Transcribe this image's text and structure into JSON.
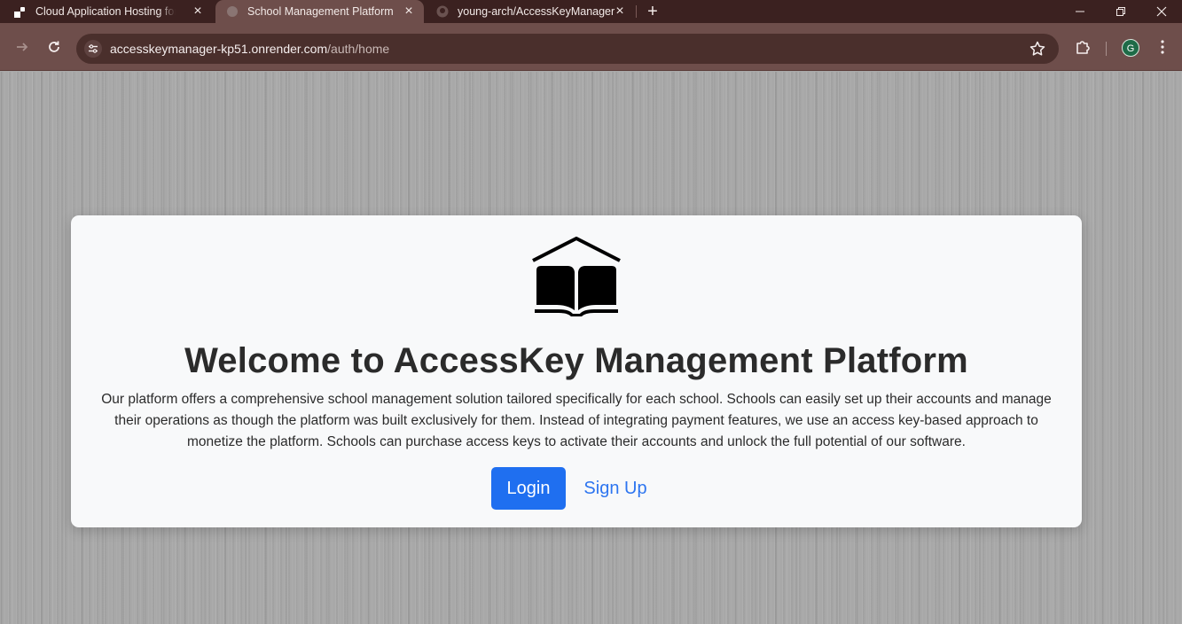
{
  "browser": {
    "tabs": [
      {
        "title": "Cloud Application Hosting for D",
        "favicon": "render-logo-icon"
      },
      {
        "title": "School Management Platform",
        "favicon": "globe-icon"
      },
      {
        "title": "young-arch/AccessKeyManager",
        "favicon": "github-icon"
      }
    ],
    "active_tab": 1,
    "url_domain": "accesskeymanager-kp51.onrender.com",
    "url_path": "/auth/home",
    "profile_initial": "G",
    "colors": {
      "tabstrip": "#3b2120",
      "toolbar": "#6e4e4b",
      "omnibox": "#4a2f2c",
      "profile": "#1e6b47"
    }
  },
  "page": {
    "logo_icon": "open-book-house-icon",
    "title": "Welcome to AccessKey Management Platform",
    "description": "Our platform offers a comprehensive school management solution tailored specifically for each school. Schools can easily set up their accounts and manage their operations as though the platform was built exclusively for them. Instead of integrating payment features, we use an access key-based approach to monetize the platform. Schools can purchase access keys to activate their accounts and unlock the full potential of our software.",
    "login_label": "Login",
    "signup_label": "Sign Up",
    "colors": {
      "primary": "#1f6ff0",
      "card": "#f8f9fa",
      "text": "#2b2b2b"
    }
  }
}
